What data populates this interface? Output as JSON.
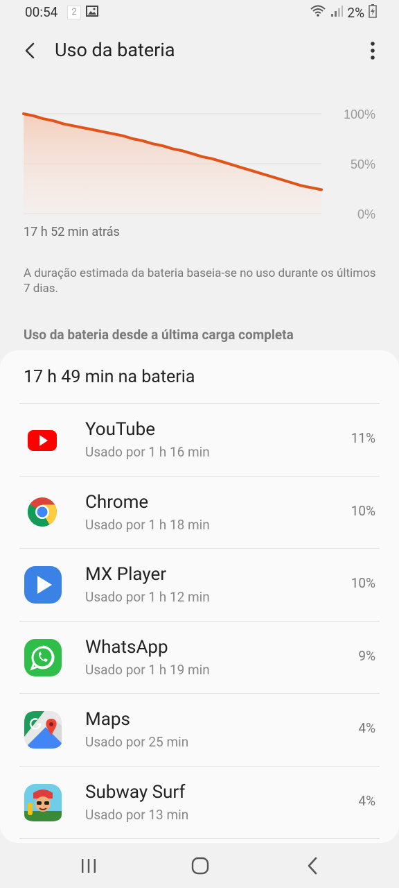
{
  "status_bar": {
    "time": "00:54",
    "notification_count": "2",
    "battery_percent": "2%"
  },
  "header": {
    "title": "Uso da bateria"
  },
  "chart_data": {
    "type": "area",
    "y_tick_labels": [
      "100%",
      "50%",
      "0%"
    ],
    "ylim": [
      0,
      100
    ],
    "x_caption": "17 h 52 min atrás",
    "series": [
      {
        "x": [
          0,
          1,
          2,
          3,
          4,
          5,
          6,
          7,
          8,
          9,
          10,
          11,
          12,
          13,
          14,
          15,
          16,
          17,
          18,
          19,
          20,
          21,
          22,
          23,
          24,
          25,
          26,
          27,
          28,
          29,
          30
        ],
        "values": [
          100,
          98,
          95,
          93,
          90,
          88,
          86,
          84,
          82,
          80,
          78,
          75,
          73,
          70,
          68,
          65,
          63,
          60,
          57,
          55,
          52,
          49,
          46,
          43,
          40,
          37,
          34,
          31,
          28,
          26,
          24
        ]
      }
    ],
    "grid": true,
    "accent_color": "#e0541a"
  },
  "estimate_note": "A duração estimada da bateria baseia-se no uso durante os últimos 7 dias.",
  "section_header": "Uso da bateria desde a última carga completa",
  "card": {
    "title": "17 h 49 min na bateria",
    "apps": [
      {
        "name": "YouTube",
        "usage": "Usado por 1 h 16 min",
        "percent": "11%",
        "icon": "youtube-icon"
      },
      {
        "name": "Chrome",
        "usage": "Usado por 1 h 18 min",
        "percent": "10%",
        "icon": "chrome-icon"
      },
      {
        "name": "MX Player",
        "usage": "Usado por 1 h 12 min",
        "percent": "10%",
        "icon": "mx-player-icon"
      },
      {
        "name": "WhatsApp",
        "usage": "Usado por 1 h 19 min",
        "percent": "9%",
        "icon": "whatsapp-icon"
      },
      {
        "name": "Maps",
        "usage": "Usado por 25 min",
        "percent": "4%",
        "icon": "maps-icon"
      },
      {
        "name": "Subway Surf",
        "usage": "Usado por 13 min",
        "percent": "4%",
        "icon": "subway-surf-icon"
      }
    ]
  }
}
